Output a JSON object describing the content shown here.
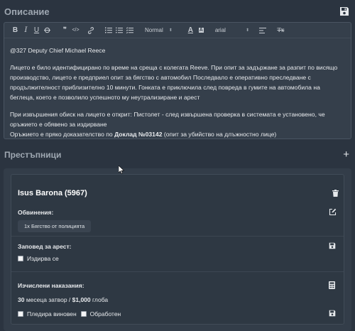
{
  "description": {
    "title": "Описание",
    "toolbar": {
      "format_select": "Normal",
      "font_select": "arial",
      "bold_glyph": "B",
      "italic_glyph": "I",
      "underline_glyph": "U",
      "quote_glyph": "❞",
      "code_glyph": "</>",
      "text_color_glyph": "A",
      "bg_color_glyph": "A",
      "clear_glyph": "Tx"
    },
    "content": {
      "p1": "@327 Deputy Chief Michael Reece",
      "p2": "Лицето е било идентифицирано по време на среща с колегата Reeve. При опит за задържане за разпит по висящо производство, лицето е предприел опит за бягство с автомобил Последвало е оперативно преследване с продължителност приблизително 10 минути. Гонката е приключила след повреда в гумите на автомобила на беглеца, което е позволило успешното му неутрализиране и арест",
      "p3_line1": "При извършения обиск на лицето е открит: Пистолет - след извършена проверка в системата е установено, че оръжието е обявено за издирване",
      "p3_line2_pre": "Оръжието е пряко доказателство по ",
      "p3_line2_bold": "Доклад №03142",
      "p3_line2_post": " (опит за убийство на длъжностно лице)"
    }
  },
  "criminals": {
    "title": "Престъпници",
    "add_glyph": "+",
    "items": [
      {
        "name": "Isus Barona (5967)",
        "charges_label": "Обвинения:",
        "charges": [
          "1x Бягство от полицията"
        ],
        "warrant_label": "Заповед за арест:",
        "wanted_label": "Издирва се",
        "penalties_label": "Изчислени наказания:",
        "months": "30",
        "months_text": " месеца затвор / ",
        "fine": "$1,000",
        "fine_text": " глоба",
        "pleaded_guilty_label": "Пледира виновен",
        "processed_label": "Обработен"
      }
    ]
  },
  "colors": {
    "background": "#2b3440",
    "editor_bg": "#353f4b",
    "card_bg": "#2e3843",
    "text": "#e8eaed",
    "muted_heading": "#9ea7b1"
  }
}
